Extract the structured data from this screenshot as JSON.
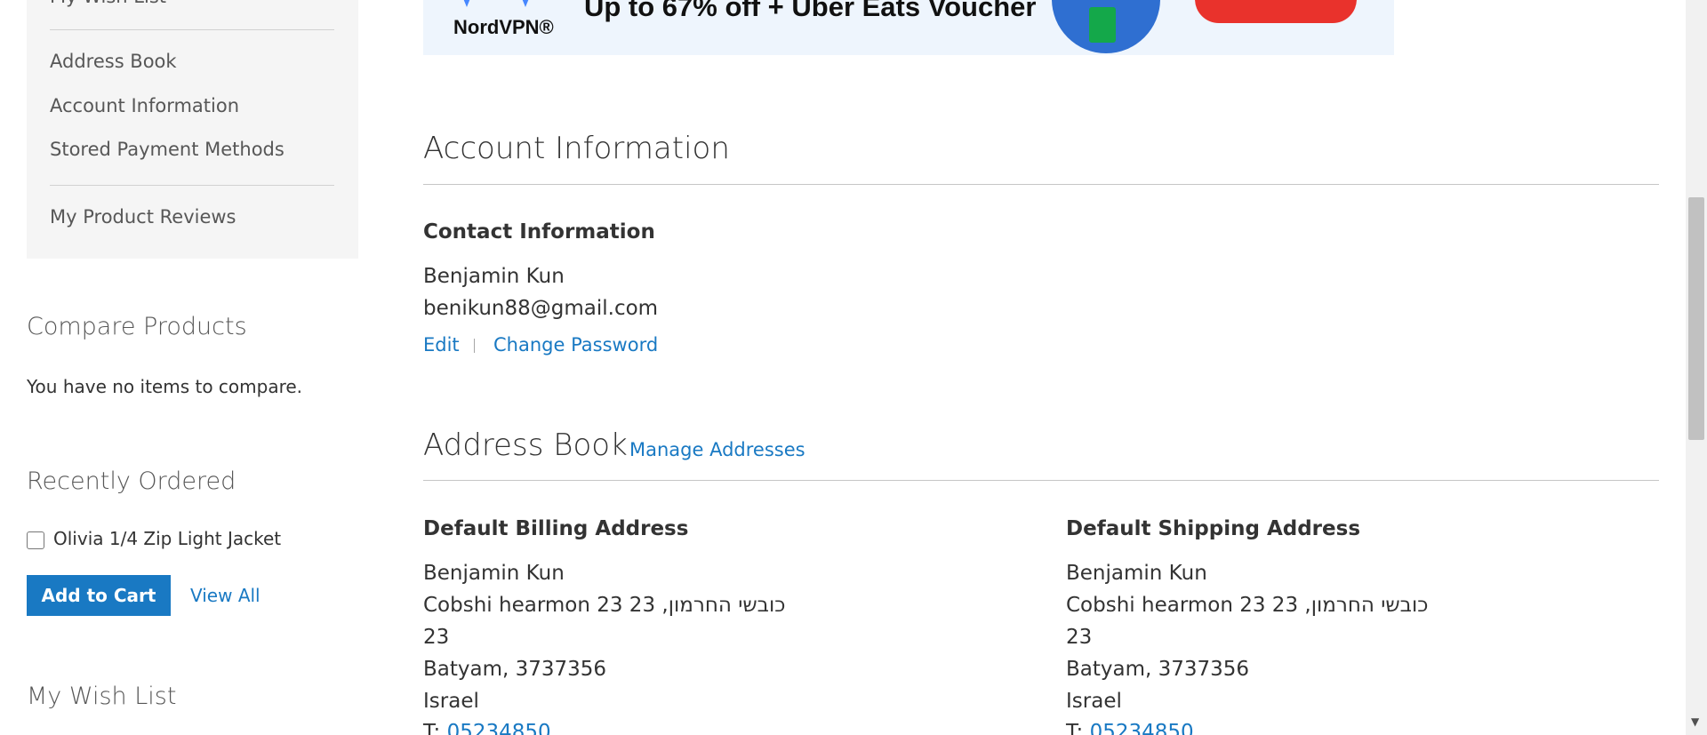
{
  "sidebar": {
    "nav_partial_top": "My Wish List",
    "nav_items": [
      "Address Book",
      "Account Information",
      "Stored Payment Methods"
    ],
    "nav_reviews": "My Product Reviews"
  },
  "compare": {
    "title": "Compare Products",
    "empty_text": "You have no items to compare."
  },
  "recently_ordered": {
    "title": "Recently Ordered",
    "item_label": "Olivia 1/4 Zip Light Jacket",
    "add_to_cart": "Add to Cart",
    "view_all": "View All"
  },
  "wishlist": {
    "title": "My Wish List"
  },
  "banner": {
    "brand": "NordVPN®",
    "headline": "Up to 67% off + Uber Eats Voucher"
  },
  "account_info": {
    "title": "Account Information",
    "contact": {
      "title": "Contact Information",
      "name": "Benjamin Kun",
      "email": "benikun88@gmail.com",
      "edit": "Edit",
      "change_password": "Change Password"
    }
  },
  "address_book": {
    "title": "Address Book",
    "manage": "Manage Addresses",
    "billing": {
      "title": "Default Billing Address",
      "name": "Benjamin Kun",
      "street": "Cobshi hearmon 23 23 ,כובשי החרמון",
      "street2": "23",
      "city": "Batyam, 3737356",
      "country": "Israel",
      "phone_prefix": "T:",
      "phone": "05234850"
    },
    "shipping": {
      "title": "Default Shipping Address",
      "name": "Benjamin Kun",
      "street": "Cobshi hearmon 23 23 ,כובשי החרמון",
      "street2": "23",
      "city": "Batyam, 3737356",
      "country": "Israel",
      "phone_prefix": "T:",
      "phone": "05234850"
    }
  },
  "colors": {
    "link": "#1979c3",
    "button": "#1979c3",
    "sidebar_bg": "#f5f5f5"
  }
}
